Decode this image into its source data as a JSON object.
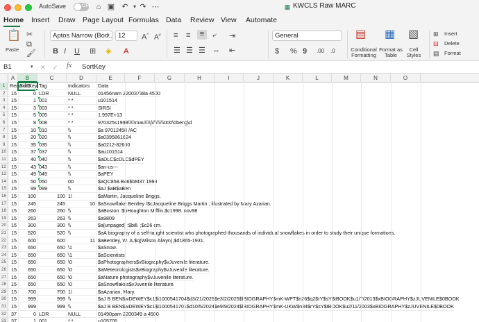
{
  "titlebar": {
    "autosave_label": "AutoSave",
    "autosave_state": "OFF",
    "doc_title": "KWCLS Raw MARC"
  },
  "ribbon_tabs": [
    "Home",
    "Insert",
    "Draw",
    "Page Layout",
    "Formulas",
    "Data",
    "Review",
    "View",
    "Automate"
  ],
  "ribbon": {
    "paste_label": "Paste",
    "font_name": "Aptos Narrow (Bod...",
    "font_size": "12",
    "number_format": "General",
    "conditional_formatting": "Conditional Formatting",
    "format_as_table": "Format as Table",
    "cell_styles": "Cell Styles",
    "insert_label": "Insert",
    "delete_label": "Delete",
    "format_label": "Format"
  },
  "formula_bar": {
    "name_box": "B1",
    "fx": "fx",
    "content": "SortKey"
  },
  "grid": {
    "columns": [
      "A",
      "B",
      "C",
      "D",
      "E",
      "F",
      "G",
      "H",
      "I",
      "J",
      "K",
      "L",
      "M",
      "N",
      "O"
    ],
    "row_numbers": [
      "1",
      "2",
      "3",
      "4",
      "5",
      "6",
      "7",
      "8",
      "9",
      "10",
      "11",
      "12",
      "13",
      "14",
      "15",
      "16",
      "17",
      "18",
      "19",
      "20",
      "21",
      "22",
      "23",
      "24",
      "25",
      "26",
      "27",
      "28",
      "29",
      "30",
      "31",
      "32",
      "33"
    ],
    "rows": [
      {
        "a": "RecordID",
        "b": "SortKey",
        "c": "Tag",
        "d": "Indicators",
        "e": "Data"
      },
      {
        "a": "15",
        "b": "0",
        "c": "LDR",
        "d": "NULL",
        "e": "01456nam  22003738a 4500"
      },
      {
        "a": "15",
        "b": "1",
        "c": "001",
        "d": "* *",
        "e": "u101514"
      },
      {
        "a": "15",
        "b": "3",
        "c": "003",
        "d": "* *",
        "e": "SIRSI"
      },
      {
        "a": "15",
        "b": "5",
        "c": "005",
        "d": "* *",
        "e": "1.997E+13"
      },
      {
        "a": "15",
        "b": "8",
        "c": "008",
        "d": "* *",
        "e": "970325s1998\\\\\\\\\\mau\\\\\\\\j\\\\\\\\\\\\\\\\\\000\\0beng\\d"
      },
      {
        "a": "15",
        "b": "10",
        "c": "010",
        "d": "\\\\",
        "e": "$a  97012458  /AC"
      },
      {
        "a": "15",
        "b": "20",
        "c": "020",
        "d": "\\\\",
        "e": "$a0395861624"
      },
      {
        "a": "15",
        "b": "35",
        "c": "035",
        "d": "\\\\",
        "e": "$a0212-82660"
      },
      {
        "a": "15",
        "b": "37",
        "c": "037",
        "d": "\\\\",
        "e": "$au101514"
      },
      {
        "a": "15",
        "b": "40",
        "c": "040",
        "d": "\\\\",
        "e": "$aDLC$cDLC$dPEY"
      },
      {
        "a": "15",
        "b": "43",
        "c": "043",
        "d": "\\\\",
        "e": "$an-us---"
      },
      {
        "a": "15",
        "b": "49",
        "c": "049",
        "d": "\\\\",
        "e": "$aPEY"
      },
      {
        "a": "15",
        "b": "50",
        "c": "050",
        "d": "00",
        "e": "$aQC858.B46$bM37 1998"
      },
      {
        "a": "15",
        "b": "99",
        "c": "099",
        "d": "\\\\",
        "e": "$aJ $aB$aBen"
      },
      {
        "a": "15",
        "b": "100",
        "c": "100",
        "d": "1\\",
        "e": "$aMartin, Jacqueline Briggs."
      },
      {
        "a": "15",
        "b": "245",
        "c": "245",
        "d": "10",
        "e": "$aSnowflake Bentley /$cJacqueline Briggs Martin ; illustrated by Mary Azarian."
      },
      {
        "a": "15",
        "b": "260",
        "c": "260",
        "d": "\\\\",
        "e": "$aBoston :$bHoughton Mifflin,$c1998. nov98"
      },
      {
        "a": "15",
        "b": "263",
        "c": "263",
        "d": "\\\\",
        "e": "$a9809"
      },
      {
        "a": "15",
        "b": "300",
        "c": "300",
        "d": "\\\\",
        "e": "$a[unpaged] :$bill. ;$c26 cm."
      },
      {
        "a": "15",
        "b": "520",
        "c": "520",
        "d": "\\\\",
        "e": "$aA biography of a self-taught scientist who photographed thousands of individual snowflakes in order to study their unique formations."
      },
      {
        "a": "15",
        "b": "600",
        "c": "600",
        "d": "11",
        "e": "$aBentley, W. A.$q(Wilson Alwyn),$d1865-1931."
      },
      {
        "a": "15",
        "b": "650",
        "c": "650",
        "d": "\\1",
        "e": "$aSnow."
      },
      {
        "a": "15",
        "b": "650",
        "c": "650",
        "d": "\\1",
        "e": "$aScientists."
      },
      {
        "a": "15",
        "b": "650",
        "c": "650",
        "d": "\\0",
        "e": "$aPhotographers$vBiography$vJuvenile literature."
      },
      {
        "a": "15",
        "b": "650",
        "c": "650",
        "d": "\\0",
        "e": "$aMeteorologists$vBiography$vJuvenile literature."
      },
      {
        "a": "15",
        "b": "650",
        "c": "650",
        "d": "\\0",
        "e": "$aNature photography$vJuvenile literature."
      },
      {
        "a": "15",
        "b": "650",
        "c": "650",
        "d": "\\0",
        "e": "$aSnowflakes$vJuvenile literature."
      },
      {
        "a": "15",
        "b": "700",
        "c": "700",
        "d": "1\\",
        "e": "$aAzarian, Mary."
      },
      {
        "a": "15",
        "b": "999",
        "c": "999",
        "d": "\\\\",
        "e": "$aJ B BEN$wDEWEY$c1$i1000541704$d3/21/2025$e3/2/2025$lBIOGRAPHY$mK-WPT$n26$q2$rY$sY$tBOOK$u1/7/2013$xBIOGRAPHY$zJUVENILE$0BOOK"
      },
      {
        "a": "15",
        "b": "999",
        "c": "999",
        "d": "\\\\",
        "e": "$aJ B BEN$wDEWEY$c1$i1000541701$d10/5/2024$e9/9/2024$lBIOGRAPHY$mK-UKW$n34$rY$sY$tBOOK$u2/11/2003$xBIOGRAPHY$zJUVENILE$0BOOK"
      },
      {
        "a": "37",
        "b": "0",
        "c": "LDR",
        "d": "NULL",
        "e": "01490pam  2200349 a 4500"
      },
      {
        "a": "37",
        "b": "1",
        "c": "001",
        "d": "* *",
        "e": "u105705"
      }
    ]
  }
}
